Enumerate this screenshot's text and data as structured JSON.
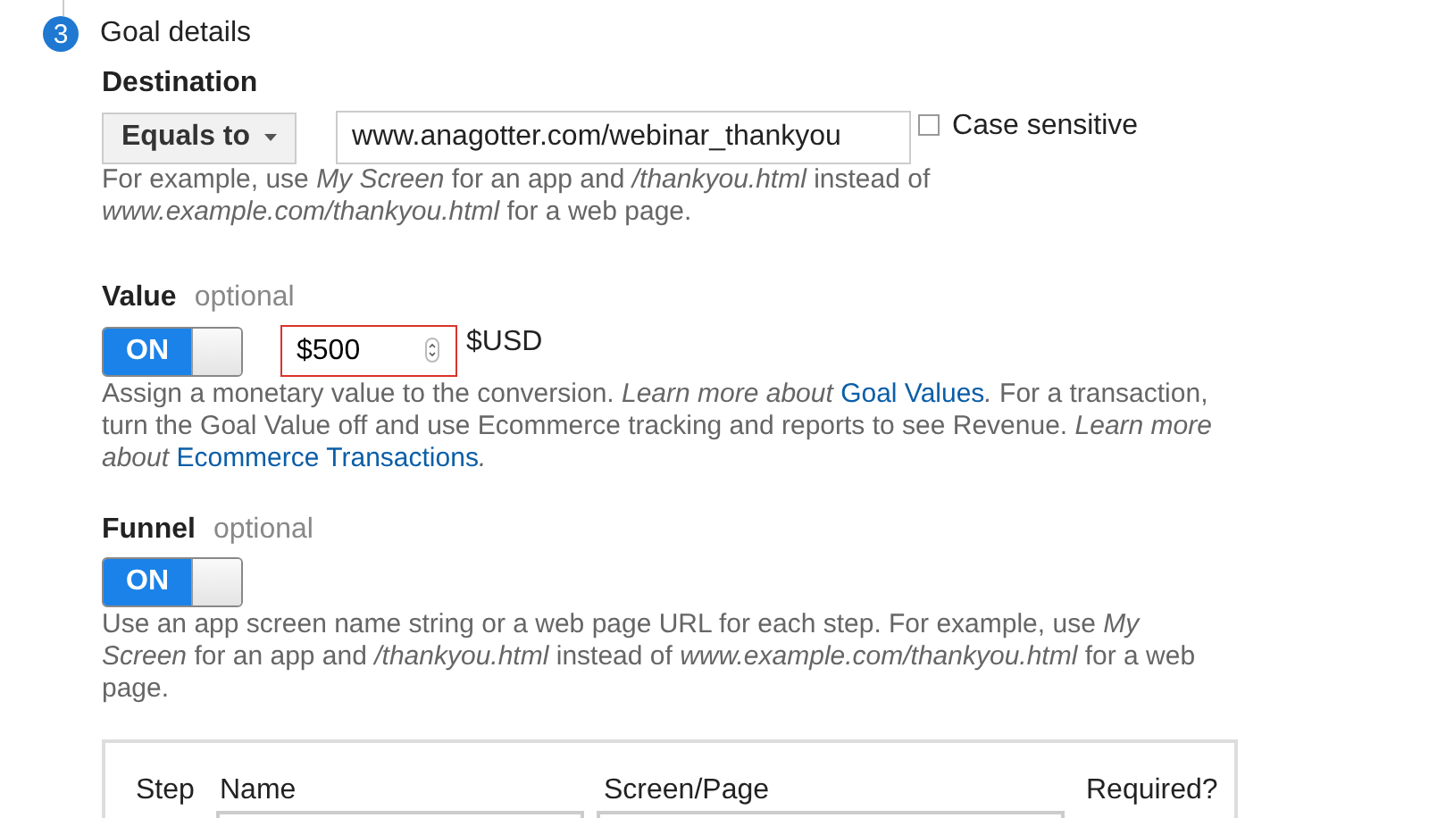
{
  "step": {
    "number": "3",
    "title": "Goal details"
  },
  "destination": {
    "label": "Destination",
    "match_type": "Equals to",
    "value": "www.anagotter.com/webinar_thankyou",
    "case_sensitive": {
      "label": "Case sensitive",
      "checked": false
    },
    "help": [
      {
        "kind": "plain",
        "text": "For example, use "
      },
      {
        "kind": "italic",
        "text": "My Screen"
      },
      {
        "kind": "plain",
        "text": " for an app and "
      },
      {
        "kind": "italic",
        "text": "/thankyou.html"
      },
      {
        "kind": "plain",
        "text": " instead of "
      },
      {
        "kind": "italic",
        "text": "www.example.com/thankyou.html"
      },
      {
        "kind": "plain",
        "text": " for a web page."
      }
    ]
  },
  "value": {
    "label": "Value",
    "hint": "optional",
    "toggle": {
      "label": "ON",
      "on": true
    },
    "amount": "$500",
    "invalid": true,
    "currency": "$USD",
    "help": [
      {
        "kind": "plain",
        "text": "Assign a monetary value to the conversion. "
      },
      {
        "kind": "italic",
        "text": "Learn more about "
      },
      {
        "kind": "link",
        "text": "Goal Values"
      },
      {
        "kind": "italic",
        "text": "."
      },
      {
        "kind": "plain",
        "text": " For a transaction, turn the Goal Value off and use Ecommerce tracking and reports to see Revenue. "
      },
      {
        "kind": "italic",
        "text": "Learn more about "
      },
      {
        "kind": "link",
        "text": "Ecommerce Transactions"
      },
      {
        "kind": "italic",
        "text": "."
      }
    ]
  },
  "funnel": {
    "label": "Funnel",
    "hint": "optional",
    "toggle": {
      "label": "ON",
      "on": true
    },
    "help": [
      {
        "kind": "plain",
        "text": "Use an app screen name string or a web page URL for each step. For example, use "
      },
      {
        "kind": "italic",
        "text": "My Screen"
      },
      {
        "kind": "plain",
        "text": " for an app and "
      },
      {
        "kind": "italic",
        "text": "/thankyou.html"
      },
      {
        "kind": "plain",
        "text": " instead of "
      },
      {
        "kind": "italic",
        "text": "www.example.com/thankyou.html"
      },
      {
        "kind": "plain",
        "text": " for a web page."
      }
    ],
    "table": {
      "columns": [
        "Step",
        "Name",
        "Screen/Page",
        "Required?"
      ]
    }
  }
}
